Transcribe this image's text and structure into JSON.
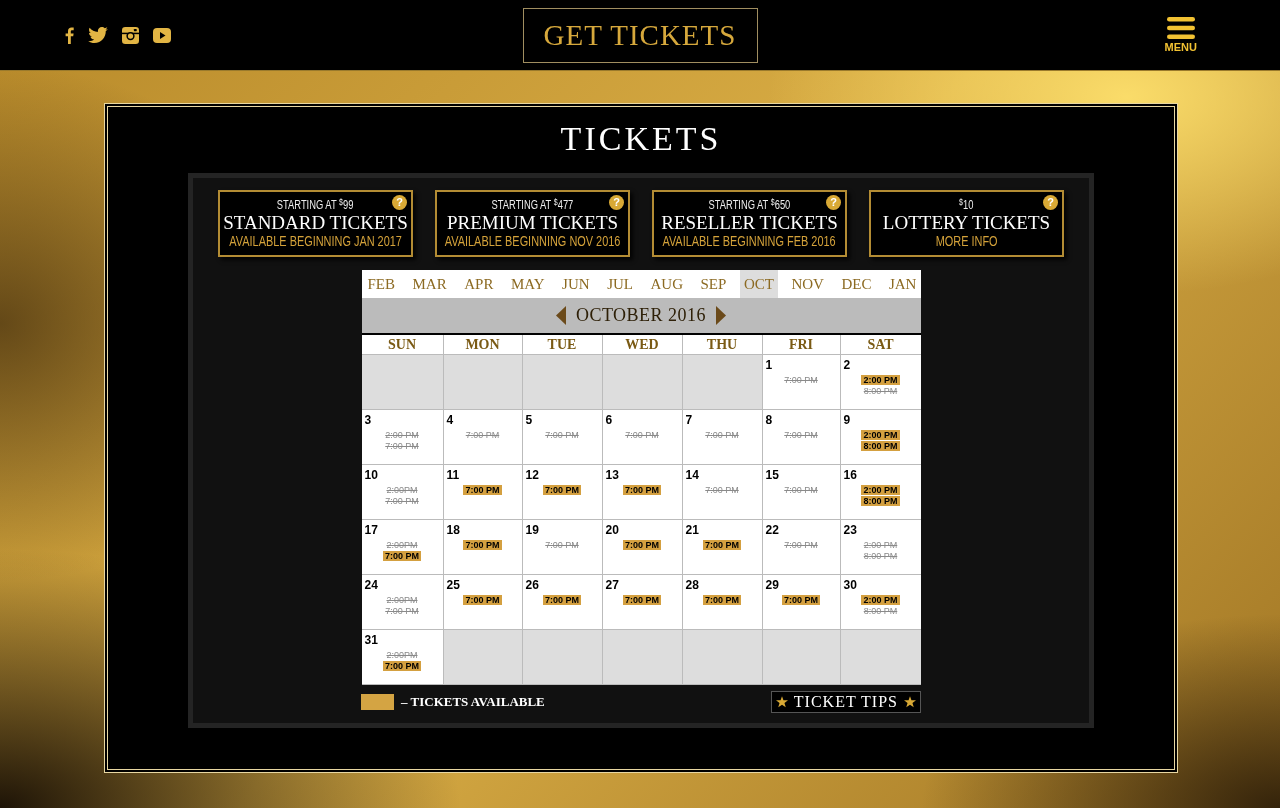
{
  "header": {
    "cta": "GET TICKETS",
    "menu_label": "MENU"
  },
  "page_title": "TICKETS",
  "ticket_types": [
    {
      "price": "STARTING AT $^{$}$99",
      "name": "STANDARD TICKETS",
      "note": "AVAILABLE BEGINNING JAN 2017",
      "help": "?"
    },
    {
      "price": "STARTING AT $^{$}$477",
      "name": "PREMIUM TICKETS",
      "note": "AVAILABLE BEGINNING NOV 2016",
      "help": "?"
    },
    {
      "price": "STARTING AT $^{$}$650",
      "name": "RESELLER TICKETS",
      "note": "AVAILABLE BEGINNING FEB 2016",
      "help": "?"
    },
    {
      "price": "$^{$}$10",
      "name": "LOTTERY TICKETS",
      "note": "MORE INFO",
      "help": "?"
    }
  ],
  "calendar": {
    "months": [
      {
        "label": "FEB",
        "selected": false
      },
      {
        "label": "MAR",
        "selected": false
      },
      {
        "label": "APR",
        "selected": false
      },
      {
        "label": "MAY",
        "selected": false
      },
      {
        "label": "JUN",
        "selected": false
      },
      {
        "label": "JUL",
        "selected": false
      },
      {
        "label": "AUG",
        "selected": false
      },
      {
        "label": "SEP",
        "selected": false
      },
      {
        "label": "OCT",
        "selected": true
      },
      {
        "label": "NOV",
        "selected": false
      },
      {
        "label": "DEC",
        "selected": false
      },
      {
        "label": "JAN",
        "selected": false
      }
    ],
    "title": "OCTOBER 2016",
    "weekdays": [
      "SUN",
      "MON",
      "TUE",
      "WED",
      "THU",
      "FRI",
      "SAT"
    ],
    "weeks": [
      [
        {
          "kind": "blank"
        },
        {
          "kind": "blank"
        },
        {
          "kind": "blank"
        },
        {
          "kind": "blank"
        },
        {
          "kind": "blank"
        },
        {
          "kind": "day",
          "day": "1",
          "shows": [
            {
              "time": "7:00 PM",
              "available": false
            }
          ]
        },
        {
          "kind": "day",
          "day": "2",
          "shows": [
            {
              "time": "2:00 PM",
              "available": true
            },
            {
              "time": "8:00 PM",
              "available": false
            }
          ]
        }
      ],
      [
        {
          "kind": "day",
          "day": "3",
          "shows": [
            {
              "time": "2:00 PM",
              "available": false
            },
            {
              "time": "7:00 PM",
              "available": false
            }
          ]
        },
        {
          "kind": "day",
          "day": "4",
          "shows": [
            {
              "time": "7:00 PM",
              "available": false
            }
          ]
        },
        {
          "kind": "day",
          "day": "5",
          "shows": [
            {
              "time": "7:00 PM",
              "available": false
            }
          ]
        },
        {
          "kind": "day",
          "day": "6",
          "shows": [
            {
              "time": "7:00 PM",
              "available": false
            }
          ]
        },
        {
          "kind": "day",
          "day": "7",
          "shows": [
            {
              "time": "7:00 PM",
              "available": false
            }
          ]
        },
        {
          "kind": "day",
          "day": "8",
          "shows": [
            {
              "time": "7:00 PM",
              "available": false
            }
          ]
        },
        {
          "kind": "day",
          "day": "9",
          "shows": [
            {
              "time": "2:00 PM",
              "available": true
            },
            {
              "time": "8:00 PM",
              "available": true
            }
          ]
        }
      ],
      [
        {
          "kind": "day",
          "day": "10",
          "shows": [
            {
              "time": "2:00PM",
              "available": false
            },
            {
              "time": "7:00 PM",
              "available": false
            }
          ]
        },
        {
          "kind": "day",
          "day": "11",
          "shows": [
            {
              "time": "7:00 PM",
              "available": true
            }
          ]
        },
        {
          "kind": "day",
          "day": "12",
          "shows": [
            {
              "time": "7:00 PM",
              "available": true
            }
          ]
        },
        {
          "kind": "day",
          "day": "13",
          "shows": [
            {
              "time": "7:00 PM",
              "available": true
            }
          ]
        },
        {
          "kind": "day",
          "day": "14",
          "shows": [
            {
              "time": "7:00 PM",
              "available": false
            }
          ]
        },
        {
          "kind": "day",
          "day": "15",
          "shows": [
            {
              "time": "7:00 PM",
              "available": false
            }
          ]
        },
        {
          "kind": "day",
          "day": "16",
          "shows": [
            {
              "time": "2:00 PM",
              "available": true
            },
            {
              "time": "8:00 PM",
              "available": true
            }
          ]
        }
      ],
      [
        {
          "kind": "day",
          "day": "17",
          "shows": [
            {
              "time": "2:00PM",
              "available": false
            },
            {
              "time": "7:00 PM",
              "available": true
            }
          ]
        },
        {
          "kind": "day",
          "day": "18",
          "shows": [
            {
              "time": "7:00 PM",
              "available": true
            }
          ]
        },
        {
          "kind": "day",
          "day": "19",
          "shows": [
            {
              "time": "7:00 PM",
              "available": false
            }
          ]
        },
        {
          "kind": "day",
          "day": "20",
          "shows": [
            {
              "time": "7:00 PM",
              "available": true
            }
          ]
        },
        {
          "kind": "day",
          "day": "21",
          "shows": [
            {
              "time": "7:00 PM",
              "available": true
            }
          ]
        },
        {
          "kind": "day",
          "day": "22",
          "shows": [
            {
              "time": "7:00 PM",
              "available": false
            }
          ]
        },
        {
          "kind": "day",
          "day": "23",
          "shows": [
            {
              "time": "2:00 PM",
              "available": false
            },
            {
              "time": "8:00 PM",
              "available": false
            }
          ]
        }
      ],
      [
        {
          "kind": "day",
          "day": "24",
          "shows": [
            {
              "time": "2:00PM",
              "available": false
            },
            {
              "time": "7:00 PM",
              "available": false
            }
          ]
        },
        {
          "kind": "day",
          "day": "25",
          "shows": [
            {
              "time": "7:00 PM",
              "available": true
            }
          ]
        },
        {
          "kind": "day",
          "day": "26",
          "shows": [
            {
              "time": "7:00 PM",
              "available": true
            }
          ]
        },
        {
          "kind": "day",
          "day": "27",
          "shows": [
            {
              "time": "7:00 PM",
              "available": true
            }
          ]
        },
        {
          "kind": "day",
          "day": "28",
          "shows": [
            {
              "time": "7:00 PM",
              "available": true
            }
          ]
        },
        {
          "kind": "day",
          "day": "29",
          "shows": [
            {
              "time": "7:00 PM",
              "available": true
            }
          ]
        },
        {
          "kind": "day",
          "day": "30",
          "shows": [
            {
              "time": "2:00 PM",
              "available": true
            },
            {
              "time": "8:00 PM",
              "available": false
            }
          ]
        }
      ],
      [
        {
          "kind": "day",
          "day": "31",
          "shows": [
            {
              "time": "2:00PM",
              "available": false
            },
            {
              "time": "7:00 PM",
              "available": true
            }
          ]
        },
        {
          "kind": "blank"
        },
        {
          "kind": "blank"
        },
        {
          "kind": "blank"
        },
        {
          "kind": "blank"
        },
        {
          "kind": "blank"
        },
        {
          "kind": "blank"
        }
      ]
    ]
  },
  "legend": {
    "label": "– TICKETS AVAILABLE"
  },
  "tips_button": {
    "label": "TICKET TIPS"
  }
}
